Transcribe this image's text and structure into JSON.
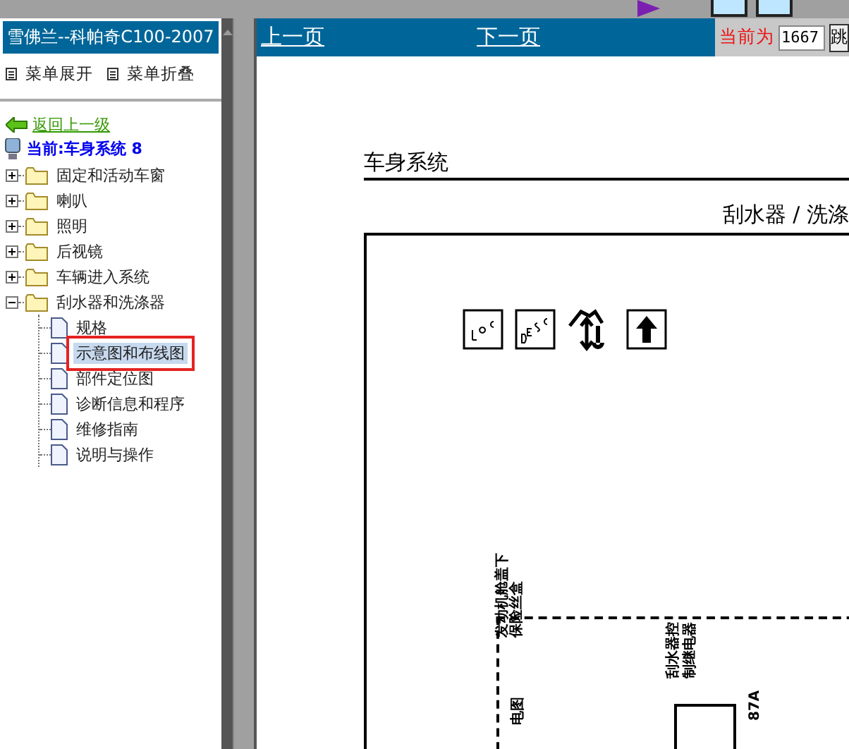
{
  "sidebar": {
    "title": "雪佛兰--科帕奇C100-2007",
    "menu": [
      "菜单展开",
      "菜单折叠"
    ],
    "back_link": "返回上一级",
    "current": "当前:车身系统 8",
    "tree": [
      {
        "label": "固定和活动车窗",
        "kind": "folder",
        "expanded": false,
        "selected": false
      },
      {
        "label": "喇叭",
        "kind": "folder",
        "expanded": false,
        "selected": false
      },
      {
        "label": "照明",
        "kind": "folder",
        "expanded": false,
        "selected": false
      },
      {
        "label": "后视镜",
        "kind": "folder",
        "expanded": false,
        "selected": false
      },
      {
        "label": "车辆进入系统",
        "kind": "folder",
        "expanded": false,
        "selected": false
      },
      {
        "label": "刮水器和洗涤器",
        "kind": "folder",
        "expanded": true,
        "selected": false,
        "children": [
          {
            "label": "规格",
            "kind": "page",
            "selected": false
          },
          {
            "label": "示意图和布线图",
            "kind": "page",
            "selected": true
          },
          {
            "label": "部件定位图",
            "kind": "page",
            "selected": false
          },
          {
            "label": "诊断信息和程序",
            "kind": "page",
            "selected": false
          },
          {
            "label": "维修指南",
            "kind": "page",
            "selected": false
          },
          {
            "label": "说明与操作",
            "kind": "page",
            "selected": false
          }
        ]
      }
    ]
  },
  "toolbar": {
    "prev": "上一页",
    "next": "下一页",
    "page_label": "当前为",
    "page_value": "1667",
    "go_button": "跳"
  },
  "document": {
    "section": "车身系统",
    "title": "刮水器 / 洗涤",
    "diagram_labels": [
      {
        "kind": "fuse",
        "text": "发动机舱盖下保险丝盒"
      },
      {
        "kind": "relay",
        "text": "刮水器控制继电器"
      },
      {
        "kind": "pin",
        "text": "87A"
      },
      {
        "kind": "side",
        "text": "电图"
      }
    ]
  }
}
